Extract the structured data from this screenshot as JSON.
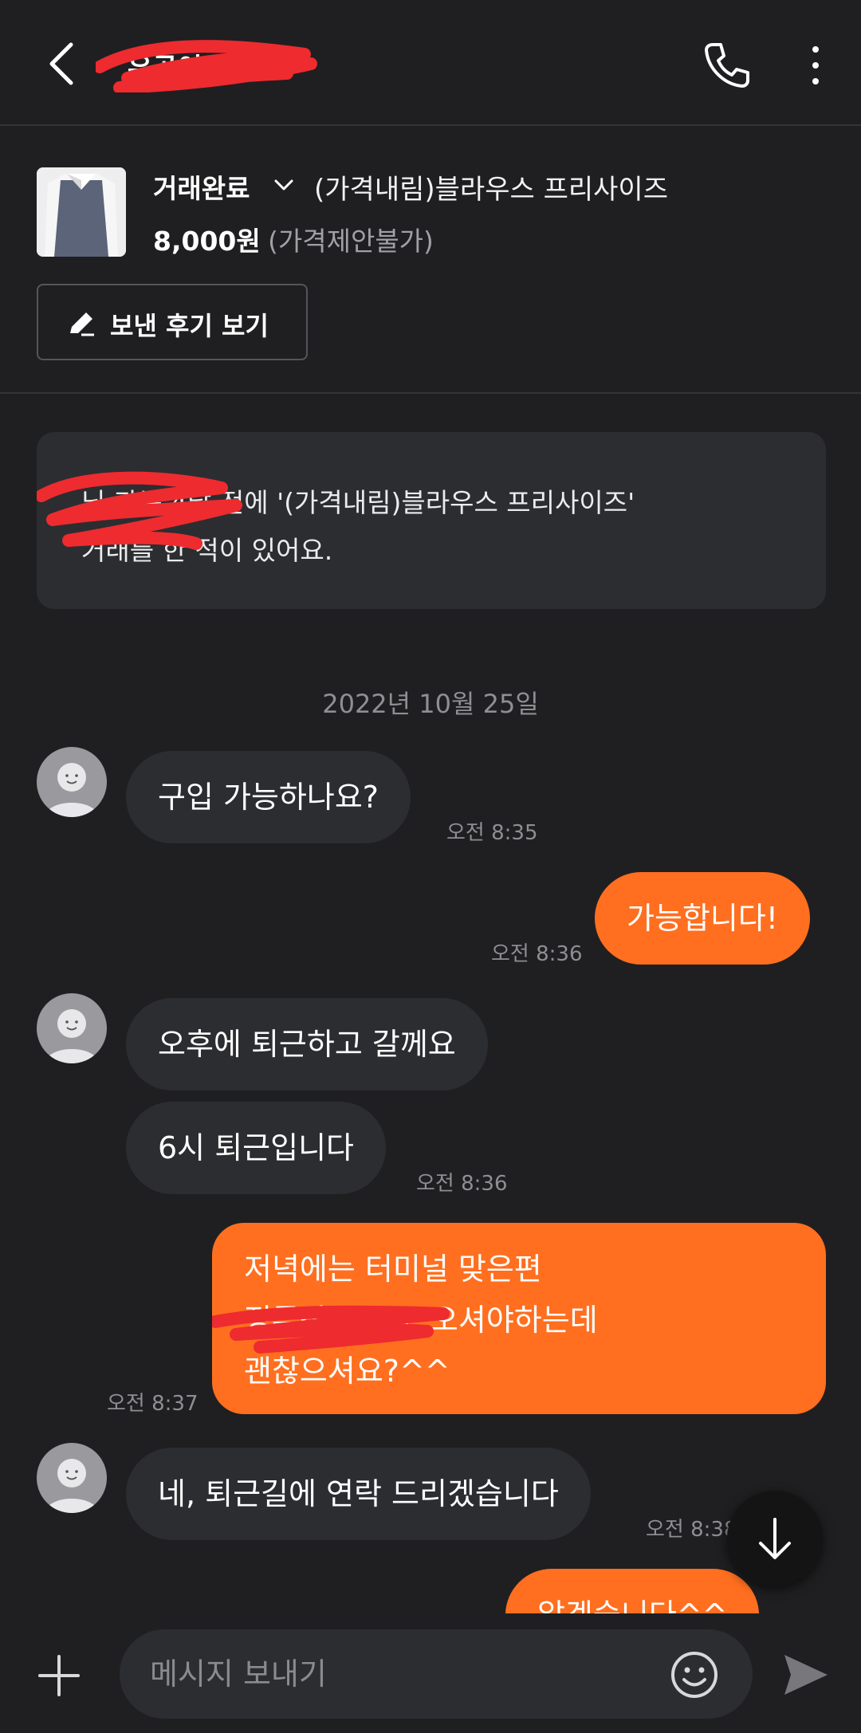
{
  "header": {
    "seller_name": "유공이",
    "phone_icon": "phone-icon",
    "more_icon": "more-vertical-icon"
  },
  "product": {
    "status": "거래완료",
    "title": "(가격내림)블라우스 프리사이즈",
    "price": "8,000원",
    "price_note": "(가격제안불가)",
    "review_button": "보낸 후기 보기"
  },
  "notice": {
    "line1": "님 과는 4달 전에 '(가격내림)블라우스 프리사이즈'",
    "line2": "거래를 한 적이 있어요."
  },
  "date_separator": "2022년 10월 25일",
  "messages": [
    {
      "dir": "in",
      "text": "구입 가능하나요?",
      "time": "오전 8:35"
    },
    {
      "dir": "out",
      "text": "가능합니다!",
      "time": "오전 8:36"
    },
    {
      "dir": "in",
      "text": "오후에 퇴근하고 갈께요",
      "time": ""
    },
    {
      "dir": "in",
      "text": "6시 퇴근입니다",
      "time": "오전 8:36"
    },
    {
      "dir": "out",
      "lines": [
        "저녁에는 터미널 맞은편",
        "정류장 쪽으로 오셔야하는데",
        "괜찮으셔요?^^"
      ],
      "time": "오전 8:37"
    },
    {
      "dir": "in",
      "text": "네, 퇴근길에 연락 드리겠습니다",
      "time": "오전 8:38"
    },
    {
      "dir": "out",
      "text": "알겠습니다^^",
      "time": ""
    }
  ],
  "input": {
    "placeholder": "메시지 보내기"
  },
  "colors": {
    "background": "#1f1f21",
    "incoming_bubble": "#2c2d31",
    "outgoing_bubble": "#ff6f1f",
    "redaction": "#ee2b2f"
  }
}
